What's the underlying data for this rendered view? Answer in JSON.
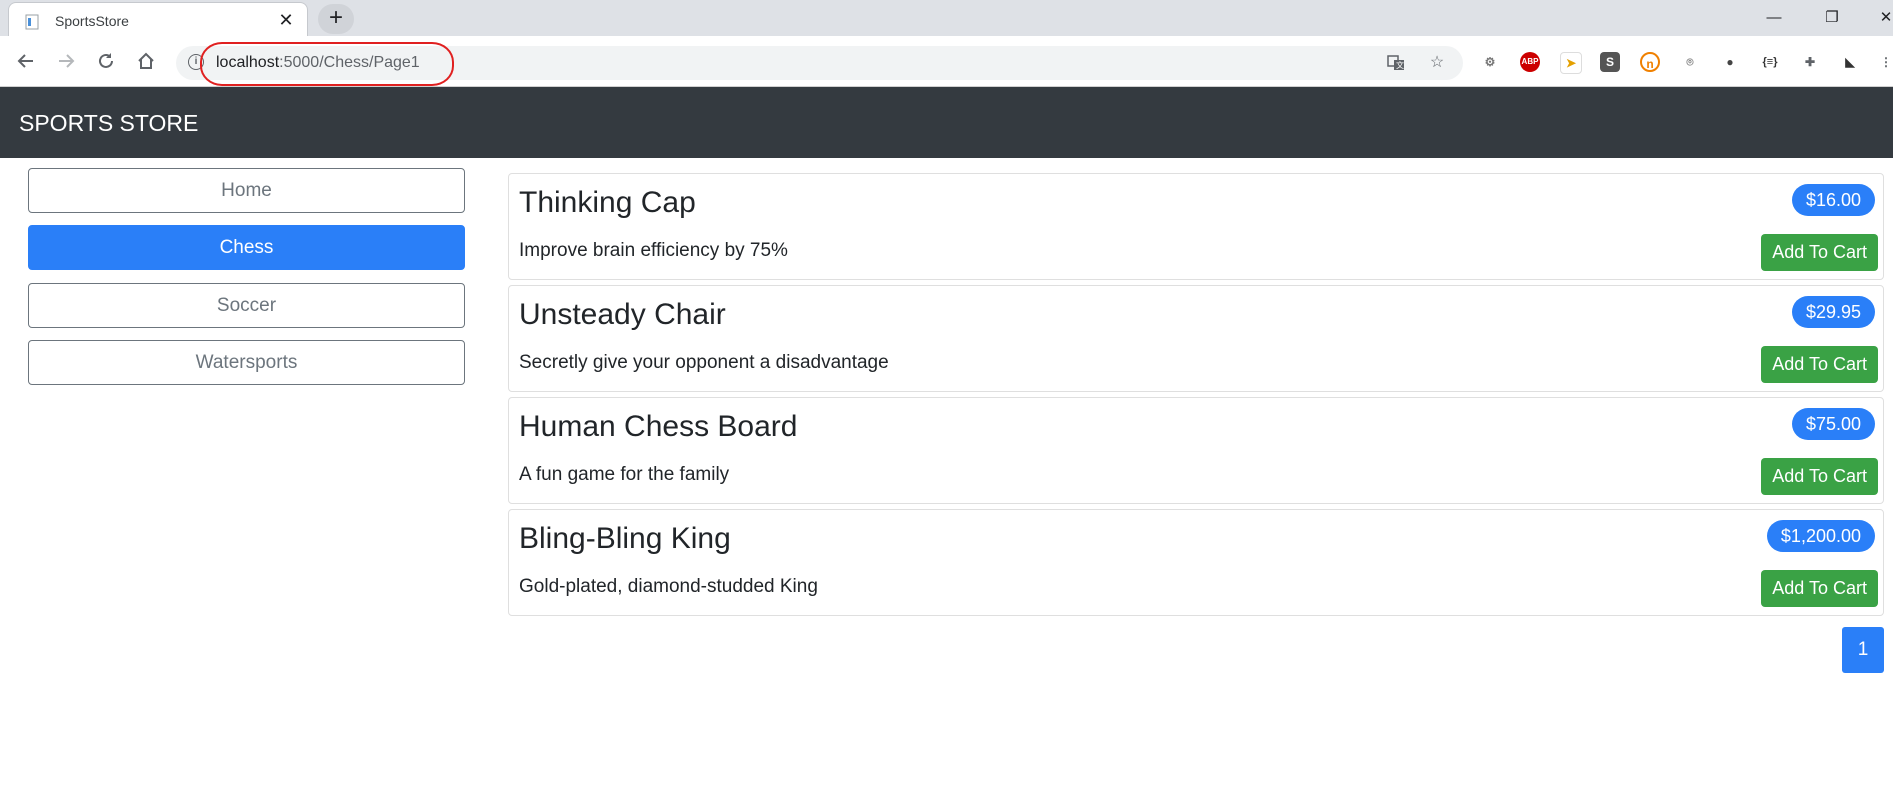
{
  "browser": {
    "tab_title": "SportsStore",
    "tab_close": "✕",
    "new_tab": "+",
    "url_host": "localhost",
    "url_path": ":5000/Chess/Page1",
    "minimize": "—",
    "restore": "❐",
    "close_window": "✕"
  },
  "store": {
    "brand": "SPORTS STORE"
  },
  "categories": [
    {
      "label": "Home",
      "active": false
    },
    {
      "label": "Chess",
      "active": true
    },
    {
      "label": "Soccer",
      "active": false
    },
    {
      "label": "Watersports",
      "active": false
    }
  ],
  "products": [
    {
      "name": "Thinking Cap",
      "description": "Improve brain efficiency by 75%",
      "price": "$16.00",
      "button": "Add To Cart"
    },
    {
      "name": "Unsteady Chair",
      "description": "Secretly give your opponent a disadvantage",
      "price": "$29.95",
      "button": "Add To Cart"
    },
    {
      "name": "Human Chess Board",
      "description": "A fun game for the family",
      "price": "$75.00",
      "button": "Add To Cart"
    },
    {
      "name": "Bling-Bling King",
      "description": "Gold-plated, diamond-studded King",
      "price": "$1,200.00",
      "button": "Add To Cart"
    }
  ],
  "pagination": {
    "current": "1"
  },
  "colors": {
    "navbar": "#343a40",
    "primary": "#2a7ff8",
    "success": "#3aa245"
  }
}
